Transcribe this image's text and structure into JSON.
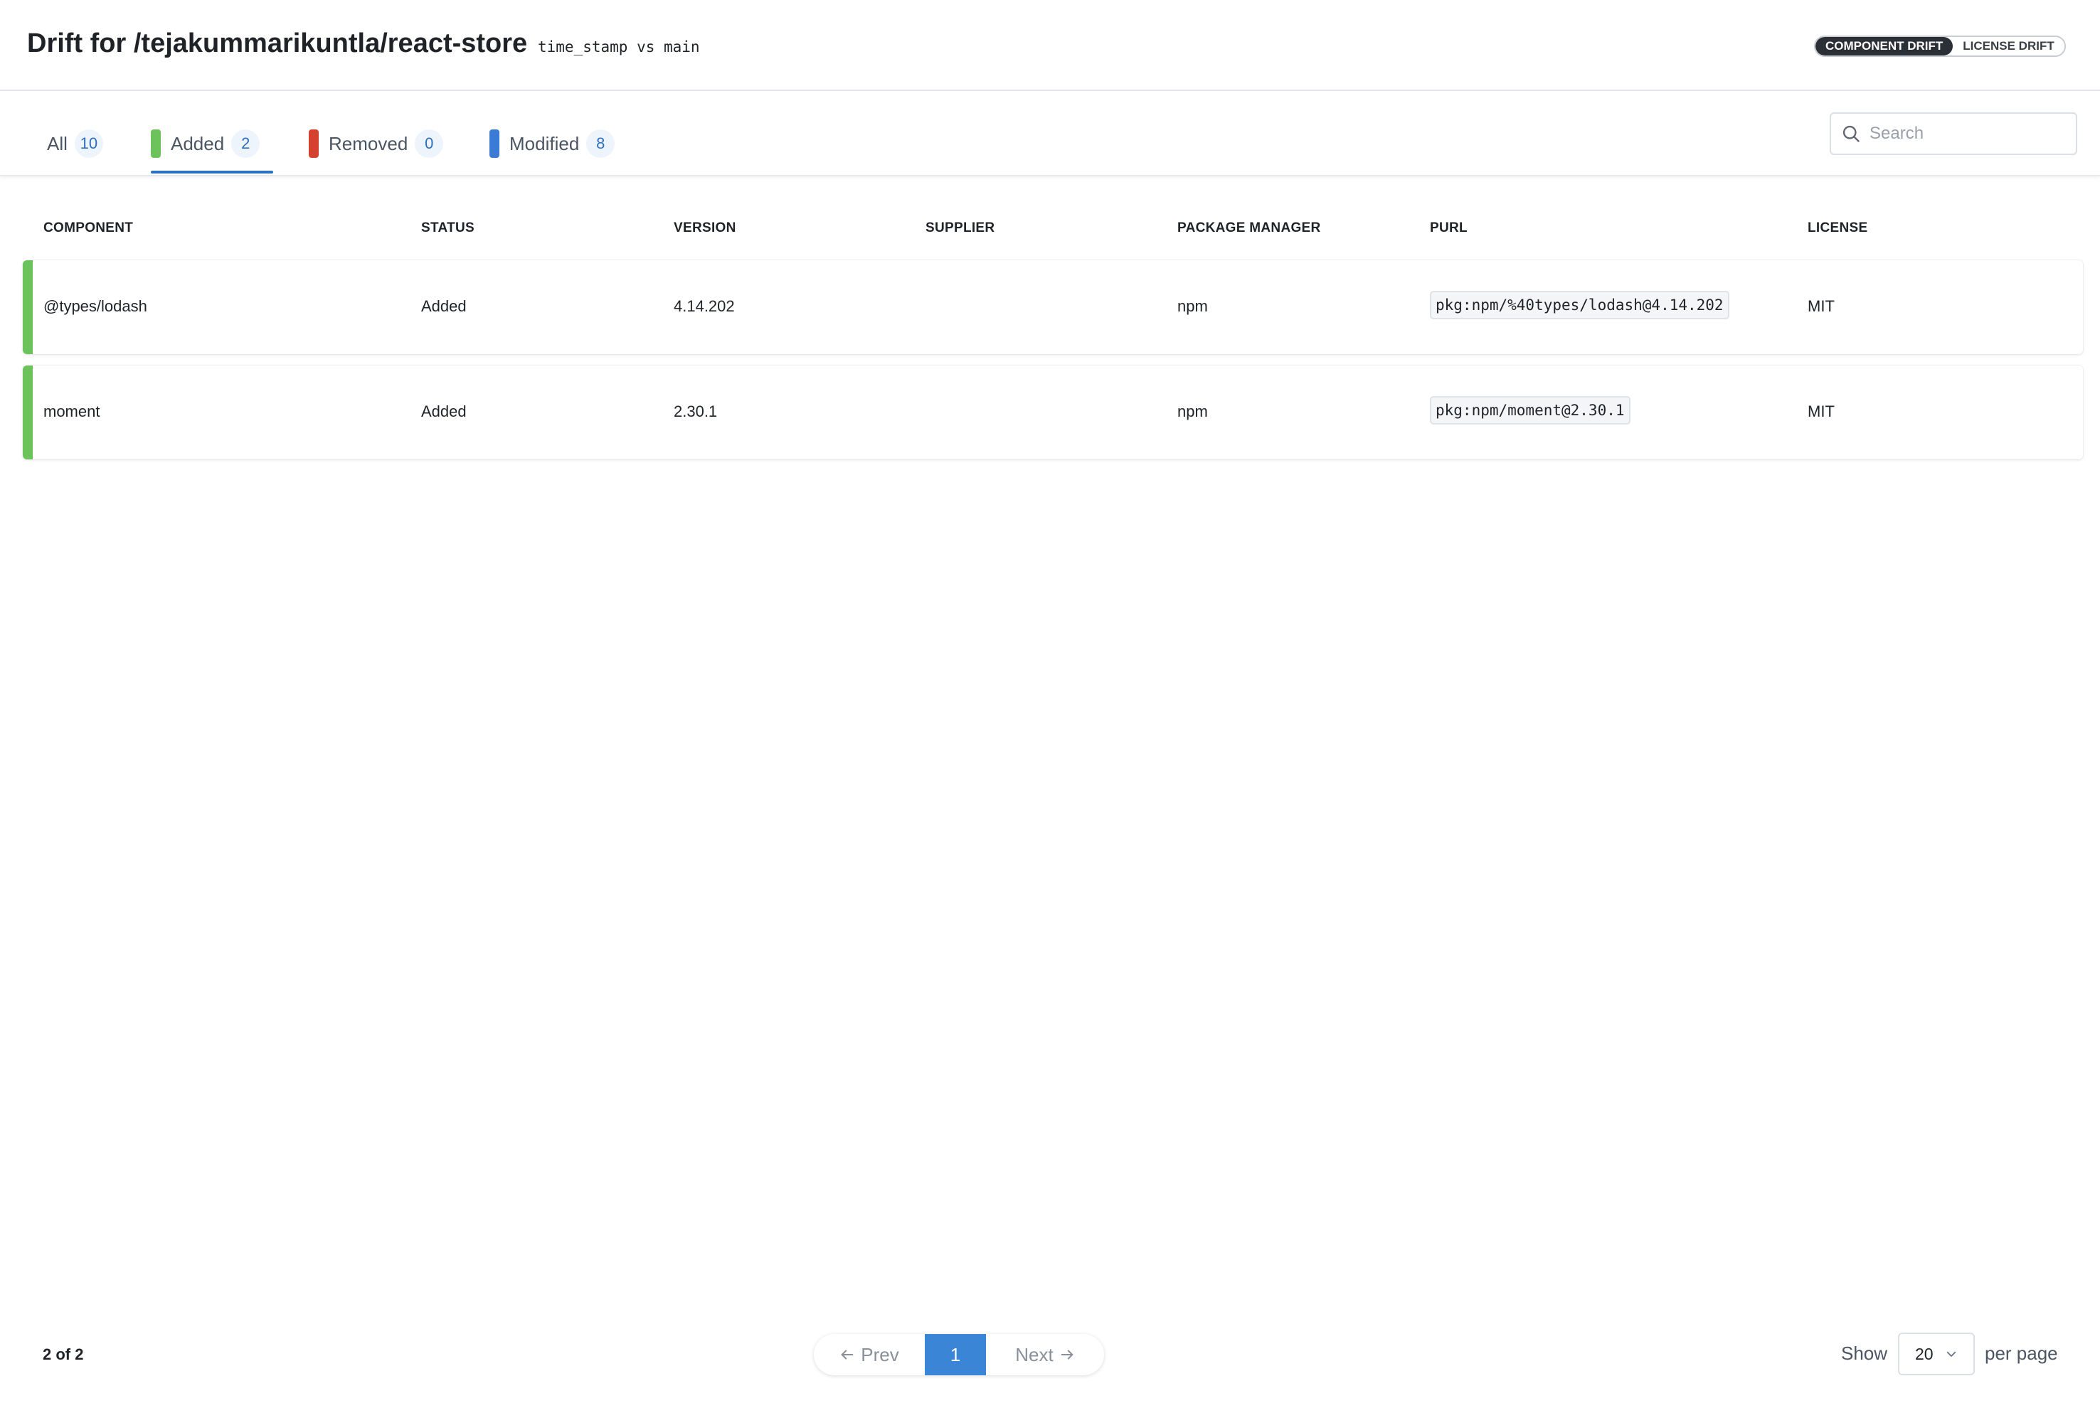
{
  "header": {
    "title": "Drift for /tejakummarikuntla/react-store",
    "branch_info": "time_stamp vs main",
    "toggles": [
      {
        "label": "COMPONENT DRIFT",
        "active": true
      },
      {
        "label": "LICENSE DRIFT",
        "active": false
      }
    ]
  },
  "tabs": [
    {
      "label": "All",
      "count": "10",
      "marker_color": null
    },
    {
      "label": "Added",
      "count": "2",
      "marker_color": "#6cc35b"
    },
    {
      "label": "Removed",
      "count": "0",
      "marker_color": "#d6412f"
    },
    {
      "label": "Modified",
      "count": "8",
      "marker_color": "#3a7bd5"
    }
  ],
  "active_tab": "Added",
  "search": {
    "placeholder": "Search",
    "value": "",
    "icon": "search-icon"
  },
  "table": {
    "columns": [
      "COMPONENT",
      "STATUS",
      "VERSION",
      "SUPPLIER",
      "PACKAGE MANAGER",
      "PURL",
      "LICENSE"
    ],
    "rows": [
      {
        "component": "@types/lodash",
        "status": "Added",
        "version": "4.14.202",
        "supplier": "",
        "package_manager": "npm",
        "purl": "pkg:npm/%40types/lodash@4.14.202",
        "license": "MIT",
        "status_color": "#6cc35b"
      },
      {
        "component": "moment",
        "status": "Added",
        "version": "2.30.1",
        "supplier": "",
        "package_manager": "npm",
        "purl": "pkg:npm/moment@2.30.1",
        "license": "MIT",
        "status_color": "#6cc35b"
      }
    ]
  },
  "footer": {
    "result_count": "2 of 2",
    "prev_label": "Prev",
    "next_label": "Next",
    "current_page": "1",
    "show_label": "Show",
    "per_page_value": "20",
    "per_page_label": "per page"
  },
  "colors": {
    "accent": "#3a85d6",
    "added": "#6cc35b",
    "removed": "#d6412f",
    "modified": "#3a7bd5"
  }
}
